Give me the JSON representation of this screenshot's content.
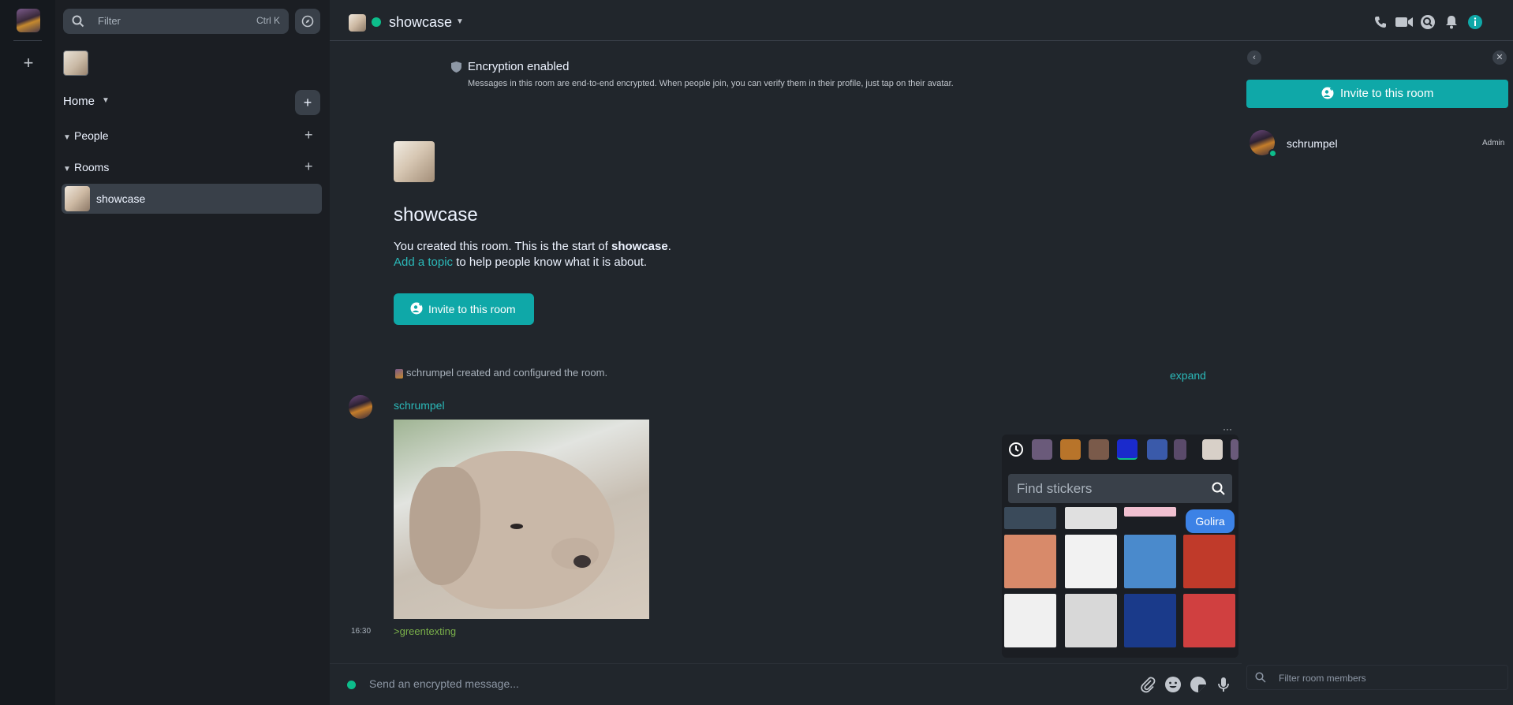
{
  "search": {
    "placeholder": "Filter",
    "shortcut": "Ctrl K"
  },
  "home": {
    "title": "Home"
  },
  "sections": [
    {
      "label": "People"
    },
    {
      "label": "Rooms"
    }
  ],
  "room_list": [
    {
      "name": "showcase",
      "selected": true
    }
  ],
  "header": {
    "room_name": "showcase"
  },
  "timeline": {
    "encryption_title": "Encryption enabled",
    "encryption_desc": "Messages in this room are end-to-end encrypted. When people join, you can verify them in their profile, just tap on their avatar.",
    "room_title": "showcase",
    "created_prefix": "You created this room. This is the start of ",
    "created_room": "showcase",
    "created_suffix": ".",
    "topic_link": "Add a topic",
    "topic_rest": " to help people know what it is about.",
    "invite_label": "Invite to this room",
    "created_event": "schrumpel created and configured the room.",
    "expand_label": "expand",
    "message": {
      "sender": "schrumpel",
      "time": "16:30",
      "text": ">greentexting"
    }
  },
  "sticker_picker": {
    "search_placeholder": "Find stickers",
    "more_label": "···",
    "tab_colors": [
      "#6a5a7a",
      "#b8742a",
      "#7a5a4a",
      "#1a2acc",
      "#3a5aaa",
      "#5a4a6a",
      "#d8d0c8"
    ],
    "golira_label": "Golira",
    "sticker_colors": [
      "#3a4a5a",
      "#e0e0e0",
      "#f0c0d0",
      "#d88a6a",
      "#f2f2f2",
      "#4a8acc",
      "#c03a2a",
      "#f0f0f0",
      "#d8d8d8",
      "#1a3a8a",
      "#d04040"
    ]
  },
  "composer": {
    "placeholder": "Send an encrypted message..."
  },
  "right_panel": {
    "invite_label": "Invite to this room",
    "member": {
      "name": "schrumpel",
      "role": "Admin"
    },
    "filter_placeholder": "Filter room members"
  },
  "colors": {
    "accent": "#0fa8a8",
    "link": "#2bb9b9",
    "greentext": "#7ab04a",
    "verified": "#0dbd8b"
  }
}
